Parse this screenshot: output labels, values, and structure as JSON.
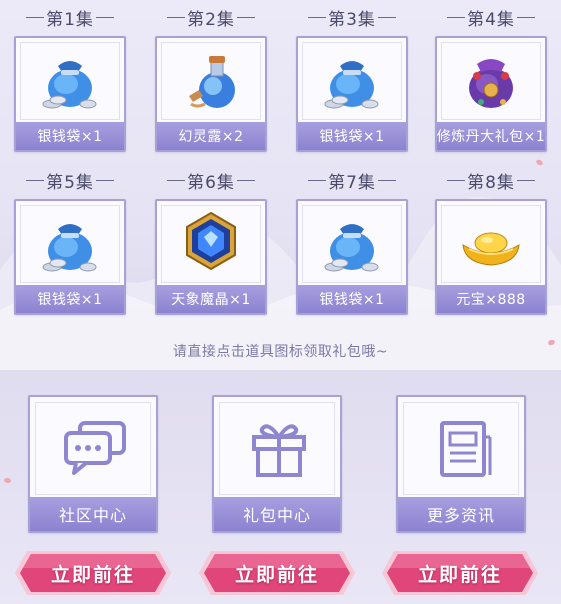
{
  "episodes": [
    {
      "title": "第1集",
      "item_label": "银钱袋×1",
      "icon": "silver-money-bag-icon"
    },
    {
      "title": "第2集",
      "item_label": "幻灵露×2",
      "icon": "potion-bottle-icon"
    },
    {
      "title": "第3集",
      "item_label": "银钱袋×1",
      "icon": "silver-money-bag-icon"
    },
    {
      "title": "第4集",
      "item_label": "修炼丹大礼包×1",
      "icon": "gift-pouch-icon"
    },
    {
      "title": "第5集",
      "item_label": "银钱袋×1",
      "icon": "silver-money-bag-icon"
    },
    {
      "title": "第6集",
      "item_label": "天象魔晶×1",
      "icon": "magic-crystal-icon"
    },
    {
      "title": "第7集",
      "item_label": "银钱袋×1",
      "icon": "silver-money-bag-icon"
    },
    {
      "title": "第8集",
      "item_label": "元宝×888",
      "icon": "gold-ingot-icon"
    }
  ],
  "hint_text": "请直接点击道具图标领取礼包哦~",
  "links": [
    {
      "label": "社区中心",
      "icon": "chat-bubbles-icon",
      "button_label": "立即前往"
    },
    {
      "label": "礼包中心",
      "icon": "gift-box-icon",
      "button_label": "立即前往"
    },
    {
      "label": "更多资讯",
      "icon": "news-document-icon",
      "button_label": "立即前往"
    }
  ],
  "colors": {
    "card_border": "#a7a2d6",
    "label_bar": "#8c82d0",
    "button_pink": "#e0467a",
    "background": "#e6e3f4"
  }
}
